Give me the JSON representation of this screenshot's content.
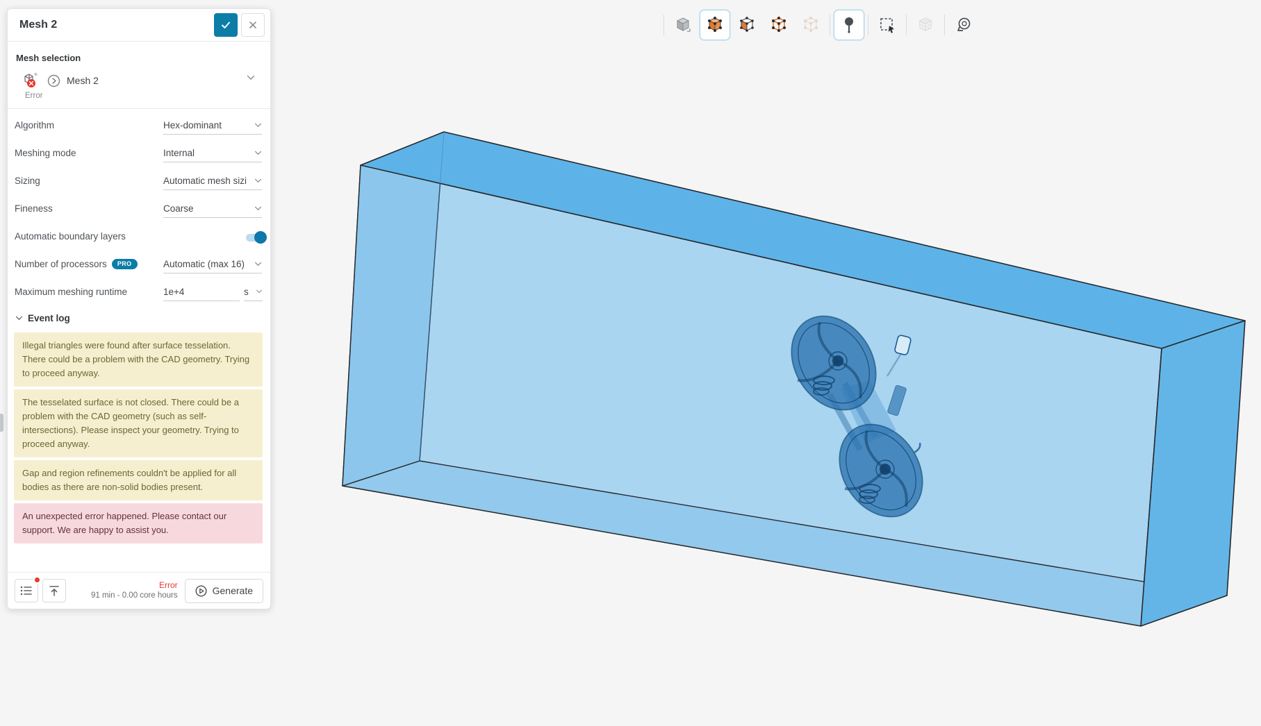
{
  "panel": {
    "title": "Mesh 2",
    "mesh_selection": {
      "label": "Mesh selection",
      "item_name": "Mesh 2",
      "status": "Error"
    },
    "fields": [
      {
        "label": "Algorithm",
        "value": "Hex-dominant",
        "type": "select"
      },
      {
        "label": "Meshing mode",
        "value": "Internal",
        "type": "select"
      },
      {
        "label": "Sizing",
        "value": "Automatic mesh sizi",
        "type": "select"
      },
      {
        "label": "Fineness",
        "value": "Coarse",
        "type": "select"
      },
      {
        "label": "Automatic boundary layers",
        "type": "toggle",
        "state": "on"
      },
      {
        "label": "Number of processors",
        "badge": "PRO",
        "value": "Automatic (max 16)",
        "type": "select"
      },
      {
        "label": "Maximum meshing runtime",
        "value": "1e+4",
        "unit": "s",
        "type": "input"
      }
    ],
    "event_log": {
      "label": "Event log",
      "messages": [
        {
          "severity": "warning",
          "text": "Illegal triangles were found after surface tesselation. There could be a problem with the CAD geometry. Trying to proceed anyway."
        },
        {
          "severity": "warning",
          "text": "The tesselated surface is not closed. There could be a problem with the CAD geometry (such as self-intersections). Please inspect your geometry. Trying to proceed anyway."
        },
        {
          "severity": "warning",
          "text": "Gap and region refinements couldn't be applied for all bodies as there are non-solid bodies present."
        },
        {
          "severity": "error",
          "text": "An unexpected error happened. Please contact our support. We are happy to assist you."
        }
      ]
    },
    "footer": {
      "status": "Error",
      "status_detail": "91 min - 0.00 core hours",
      "generate_label": "Generate"
    }
  },
  "toolbar": {
    "items": [
      {
        "icon": "view-cube-icon",
        "state": "default"
      },
      {
        "icon": "select-volumes-cube-icon",
        "state": "active"
      },
      {
        "icon": "select-faces-cube-icon",
        "state": "default"
      },
      {
        "icon": "select-edges-cube-icon",
        "state": "default"
      },
      {
        "icon": "select-vertices-cube-icon",
        "state": "disabled"
      },
      {
        "icon": "probe-pin-icon",
        "state": "active"
      },
      {
        "icon": "box-select-icon",
        "state": "default"
      },
      {
        "icon": "mesh-view-icon",
        "state": "disabled"
      },
      {
        "icon": "measure-tape-icon",
        "state": "default"
      }
    ]
  },
  "colors": {
    "accent_teal": "#0b7da6",
    "error_red": "#e8392f",
    "warning_bg": "#f6efcf",
    "warning_text": "#6e6535",
    "error_bg": "#f7d9dd",
    "error_text": "#643039",
    "selection_orange": "#e07b33",
    "domain_box_top": "#5db3e8",
    "domain_box_front": "#a9d5f1"
  }
}
